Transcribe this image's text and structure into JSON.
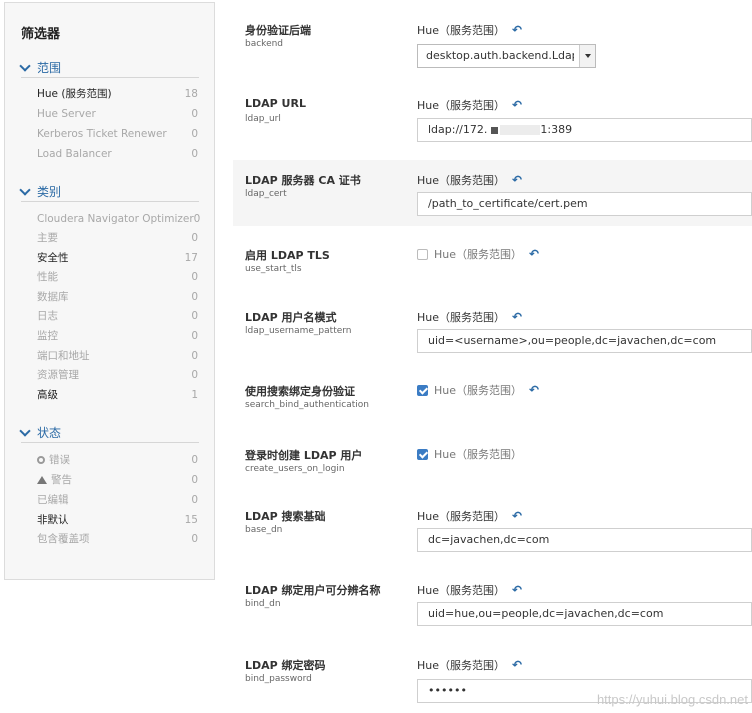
{
  "sidebar": {
    "title": "筛选器",
    "sections": [
      {
        "label": "范围",
        "items": [
          {
            "label": "Hue (服务范围)",
            "count": "18",
            "active": true
          },
          {
            "label": "Hue Server",
            "count": "0"
          },
          {
            "label": "Kerberos Ticket Renewer",
            "count": "0"
          },
          {
            "label": "Load Balancer",
            "count": "0"
          }
        ]
      },
      {
        "label": "类别",
        "items": [
          {
            "label": "Cloudera Navigator Optimizer",
            "count": "0"
          },
          {
            "label": "主要",
            "count": "0"
          },
          {
            "label": "安全性",
            "count": "17",
            "active": true
          },
          {
            "label": "性能",
            "count": "0"
          },
          {
            "label": "数据库",
            "count": "0"
          },
          {
            "label": "日志",
            "count": "0"
          },
          {
            "label": "监控",
            "count": "0"
          },
          {
            "label": "端口和地址",
            "count": "0"
          },
          {
            "label": "资源管理",
            "count": "0"
          },
          {
            "label": "高级",
            "count": "1",
            "active": true
          }
        ]
      },
      {
        "label": "状态",
        "items": [
          {
            "label": "错误",
            "count": "0",
            "icon": "error-icon"
          },
          {
            "label": "警告",
            "count": "0",
            "icon": "warning-icon"
          },
          {
            "label": "已编辑",
            "count": "0"
          },
          {
            "label": "非默认",
            "count": "15",
            "active": true
          },
          {
            "label": "包含覆盖项",
            "count": "0"
          }
        ]
      }
    ]
  },
  "configs": [
    {
      "name": "身份验证后端",
      "key": "backend",
      "scope": "Hue（服务范围）",
      "type": "select",
      "value": "desktop.auth.backend.LdapB",
      "undo": true
    },
    {
      "name": "LDAP URL",
      "key": "ldap_url",
      "scope": "Hue（服务范围）",
      "type": "text",
      "value_prefix": "ldap://172.",
      "value_suffix": "1:389",
      "undo": true
    },
    {
      "name": "LDAP 服务器 CA 证书",
      "key": "ldap_cert",
      "scope": "Hue（服务范围）",
      "type": "text",
      "value": "/path_to_certificate/cert.pem",
      "undo": true
    },
    {
      "name": "启用 LDAP TLS",
      "key": "use_start_tls",
      "scope": "Hue（服务范围）",
      "type": "checkbox",
      "checked": false,
      "undo": true
    },
    {
      "name": "LDAP 用户名模式",
      "key": "ldap_username_pattern",
      "scope": "Hue（服务范围）",
      "type": "text",
      "value": "uid=<username>,ou=people,dc=javachen,dc=com",
      "undo": true
    },
    {
      "name": "使用搜索绑定身份验证",
      "key": "search_bind_authentication",
      "scope": "Hue（服务范围）",
      "type": "checkbox",
      "checked": true,
      "undo": true
    },
    {
      "name": "登录时创建 LDAP 用户",
      "key": "create_users_on_login",
      "scope": "Hue（服务范围）",
      "type": "checkbox",
      "checked": true,
      "undo": false
    },
    {
      "name": "LDAP 搜索基础",
      "key": "base_dn",
      "scope": "Hue（服务范围）",
      "type": "text",
      "value": "dc=javachen,dc=com",
      "undo": true
    },
    {
      "name": "LDAP 绑定用户可分辨名称",
      "key": "bind_dn",
      "scope": "Hue（服务范围）",
      "type": "text",
      "value": "uid=hue,ou=people,dc=javachen,dc=com",
      "undo": true
    },
    {
      "name": "LDAP 绑定密码",
      "key": "bind_password",
      "scope": "Hue（服务范围）",
      "type": "password",
      "value": "••••••",
      "undo": true
    }
  ],
  "watermark": "https://yuhui.blog.csdn.net",
  "colors": {
    "accent": "#2b6aa5",
    "checkbox_on": "#3b7cc4",
    "row_shade": "#f5f5f5"
  }
}
